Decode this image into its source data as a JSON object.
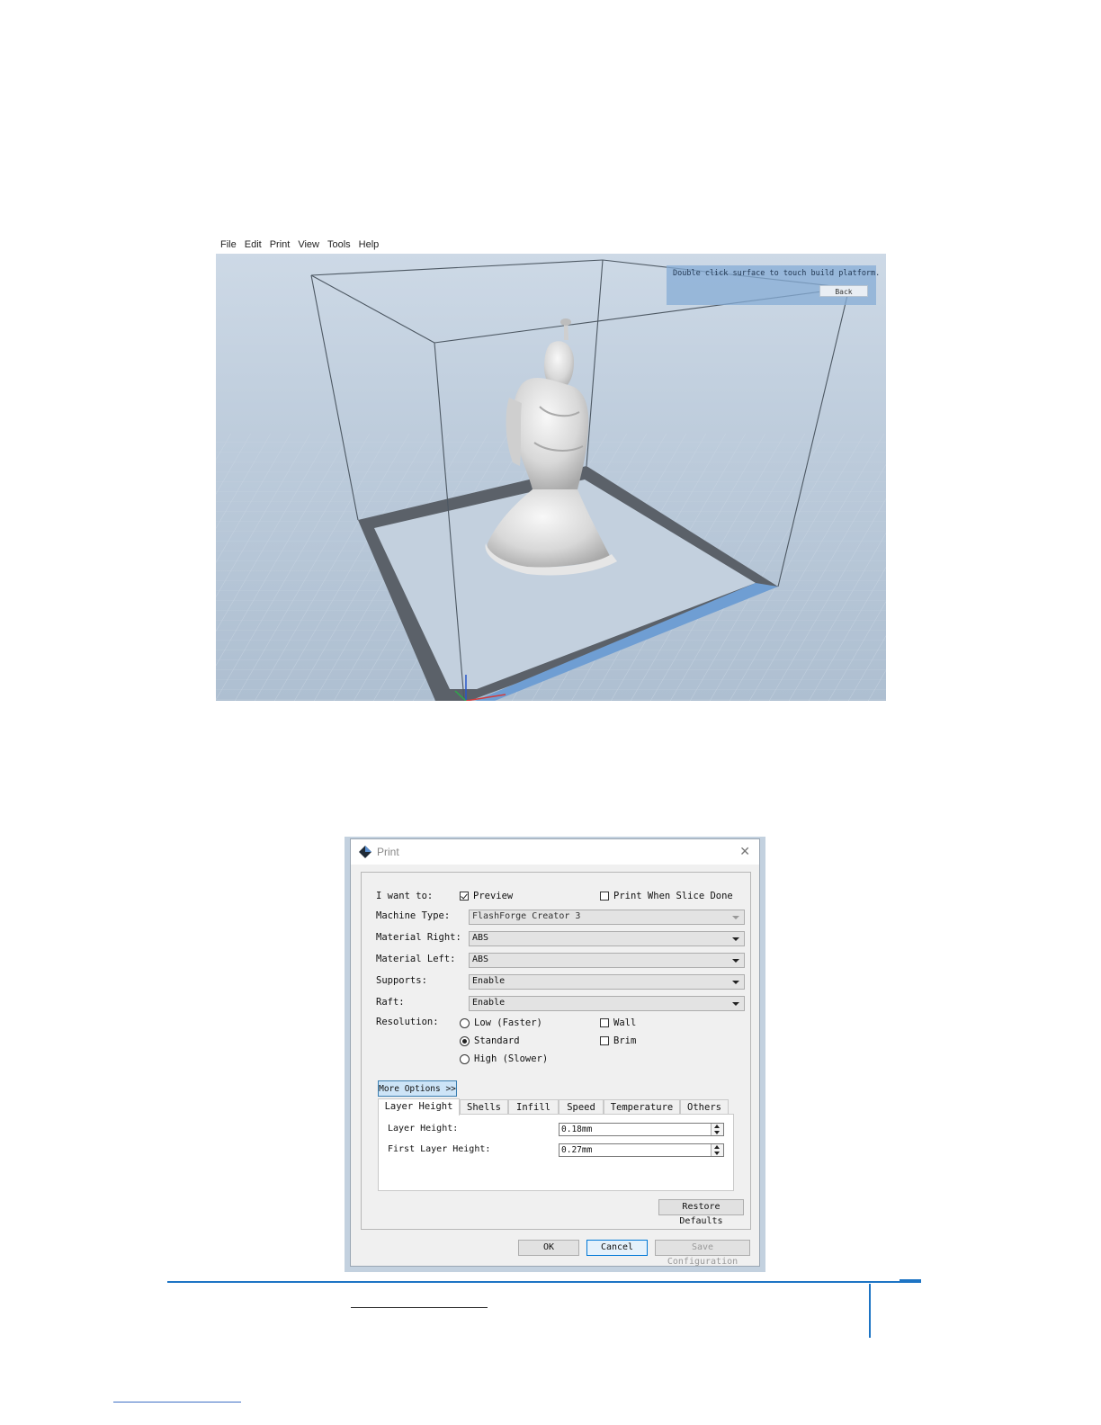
{
  "viewer": {
    "menu": [
      "File",
      "Edit",
      "Print",
      "View",
      "Tools",
      "Help"
    ],
    "hint": "Double click surface to touch build platform.",
    "back_label": "Back"
  },
  "print_dialog": {
    "title": "Print",
    "i_want_to_label": "I want to:",
    "preview_label": "Preview",
    "preview_checked": true,
    "print_when_done_label": "Print When Slice Done",
    "print_when_done_checked": false,
    "machine_type": {
      "label": "Machine Type:",
      "value": "FlashForge Creator 3"
    },
    "material_right": {
      "label": "Material Right:",
      "value": "ABS"
    },
    "material_left": {
      "label": "Material Left:",
      "value": "ABS"
    },
    "supports": {
      "label": "Supports:",
      "value": "Enable"
    },
    "raft": {
      "label": "Raft:",
      "value": "Enable"
    },
    "resolution": {
      "label": "Resolution:",
      "options": [
        "Low (Faster)",
        "Standard",
        "High (Slower)"
      ],
      "selected": "Standard"
    },
    "wall_label": "Wall",
    "brim_label": "Brim",
    "more_options_label": "More Options >>",
    "tabs": [
      "Layer Height",
      "Shells",
      "Infill",
      "Speed",
      "Temperature",
      "Others"
    ],
    "active_tab": "Layer Height",
    "layer_height": {
      "label": "Layer Height:",
      "value": "0.18mm"
    },
    "first_layer_height": {
      "label": "First Layer Height:",
      "value": "0.27mm"
    },
    "restore_defaults_label": "Restore Defaults",
    "ok_label": "OK",
    "cancel_label": "Cancel",
    "save_configuration_label": "Save Configuration"
  },
  "colors": {
    "accent": "#1d74c4",
    "build_plate_edge": "#6f9ed3",
    "viewport_bg": "#bccbdb"
  }
}
